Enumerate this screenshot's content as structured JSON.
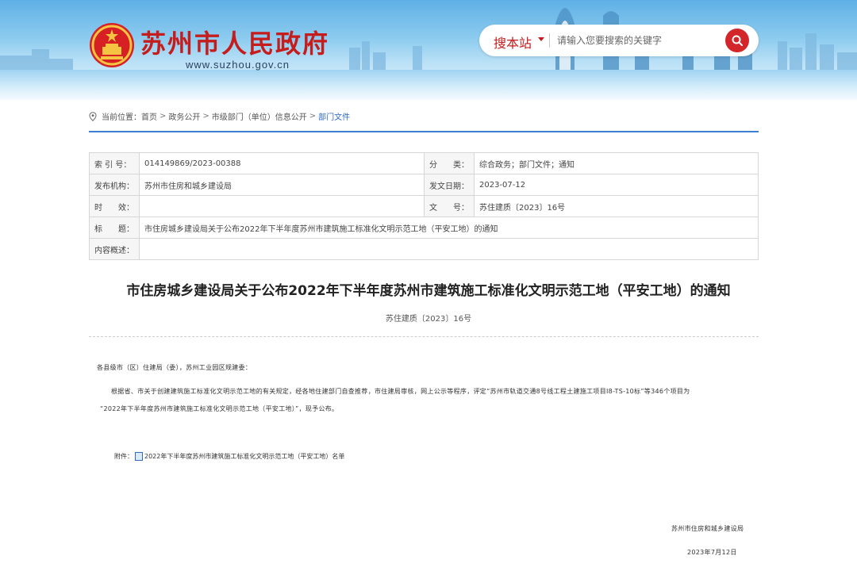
{
  "header": {
    "site_title": "苏州市人民政府",
    "site_url": "www.suzhou.gov.cn",
    "search_scope": "搜本站",
    "search_placeholder": "请输入您要搜索的关键字"
  },
  "breadcrumb": {
    "prefix": "当前位置：",
    "items": [
      "首页",
      "政务公开",
      "市级部门（单位）信息公开",
      "部门文件"
    ],
    "separator": ">"
  },
  "meta": {
    "index_label": "索 引 号：",
    "index_value": "014149869/2023-00388",
    "category_label": "分　　类：",
    "category_value": "综合政务；部门文件；通知",
    "issuer_label": "发布机构：",
    "issuer_value": "苏州市住房和城乡建设局",
    "date_label": "发文日期：",
    "date_value": "2023-07-12",
    "validity_label": "时　　效：",
    "validity_value": "",
    "docno_label": "文　　号：",
    "docno_value": "苏住建质〔2023〕16号",
    "title_label": "标　　题：",
    "title_value": "市住房城乡建设局关于公布2022年下半年度苏州市建筑施工标准化文明示范工地（平安工地）的通知",
    "summary_label": "内容概述：",
    "summary_value": ""
  },
  "article": {
    "title": "市住房城乡建设局关于公布2022年下半年度苏州市建筑施工标准化文明示范工地（平安工地）的通知",
    "doc_number": "苏住建质〔2023〕16号",
    "salutation": "各县级市（区）住建局（委），苏州工业园区规建委：",
    "para1_line1": "根据省、市关于创建建筑施工标准化文明示范工地的有关规定，经各地住建部门自查推荐，市住建局审核，网上公示等程序，评定“苏州市轨道交通8号线工程土建施工项目I8-TS-10标”等346个项目为",
    "para1_line2": "“2022年下半年度苏州市建筑施工标准化文明示范工地（平安工地）”，现予公布。",
    "attachment_label": "附件：",
    "attachment_name": "2022年下半年度苏州市建筑施工标准化文明示范工地（平安工地）名单",
    "signer": "苏州市住房和城乡建设局",
    "sign_date": "2023年7月12日"
  },
  "colors": {
    "brand_red": "#c51c1c",
    "link_blue": "#2f6bbf",
    "rule_blue": "#3b7fd0"
  }
}
